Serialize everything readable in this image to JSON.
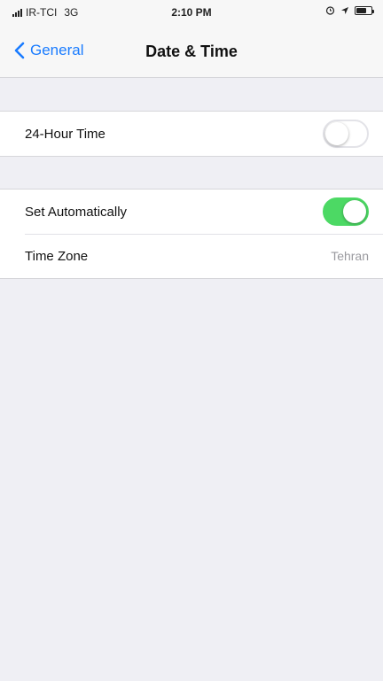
{
  "status_bar": {
    "carrier": "IR-TCI",
    "network": "3G",
    "time": "2:10 PM",
    "icons": [
      "signal-icon",
      "alarm-icon",
      "location-icon",
      "battery-icon"
    ]
  },
  "nav": {
    "back_label": "General",
    "title": "Date & Time"
  },
  "section1": {
    "hour24_label": "24-Hour Time",
    "hour24_on": false
  },
  "section2": {
    "set_auto_label": "Set Automatically",
    "set_auto_on": true,
    "time_zone_label": "Time Zone",
    "time_zone_value": "Tehran"
  },
  "colors": {
    "accent": "#1a7cff",
    "toggle_on": "#4cd964",
    "background": "#efeff4"
  }
}
